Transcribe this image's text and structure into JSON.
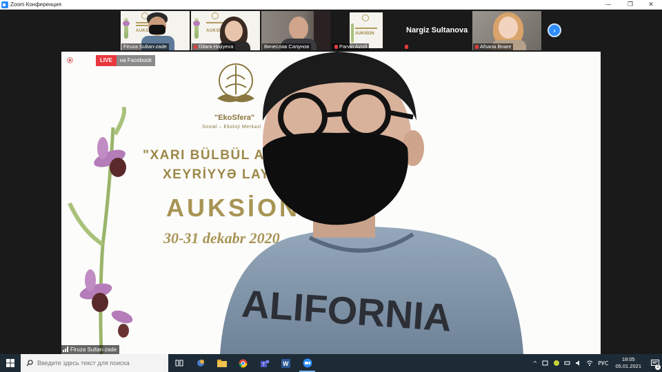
{
  "window": {
    "title": "Zoom Конференция",
    "controls": {
      "minimize": "—",
      "maximize": "❐",
      "close": "✕"
    }
  },
  "gallery": {
    "participants": [
      {
        "name": "Firuza Sultan-zade",
        "muted": false
      },
      {
        "name": "Dilara Hajiyeva",
        "muted": true
      },
      {
        "name": "Вячеслав Сапунов",
        "muted": false
      },
      {
        "name": "Parvin Azizli",
        "muted": true
      },
      {
        "name": "Nargiz Sultanova",
        "muted": true
      },
      {
        "name": "Afsana Bnare",
        "muted": true
      }
    ],
    "next_icon": "›"
  },
  "main_video": {
    "live_label": "LIVE",
    "live_platform": "на Facebook",
    "speaker_name": "Firuza Sultan-zade",
    "poster": {
      "brand": "\"EkoSfera\"",
      "brand_sub": "Sosial – Ekoloji Merkəzi",
      "headline_1": "\"XARI BÜLBÜL AL",
      "headline_2": "XEYRİYYƏ LAYİ",
      "auction": "AUKSİON",
      "dates": "30-31 dekabr 2020"
    }
  },
  "taskbar": {
    "search_placeholder": "Введите здесь текст для поиска",
    "language": "РУС",
    "time": "18:05",
    "date": "05.01.2021",
    "notifications": "2"
  }
}
